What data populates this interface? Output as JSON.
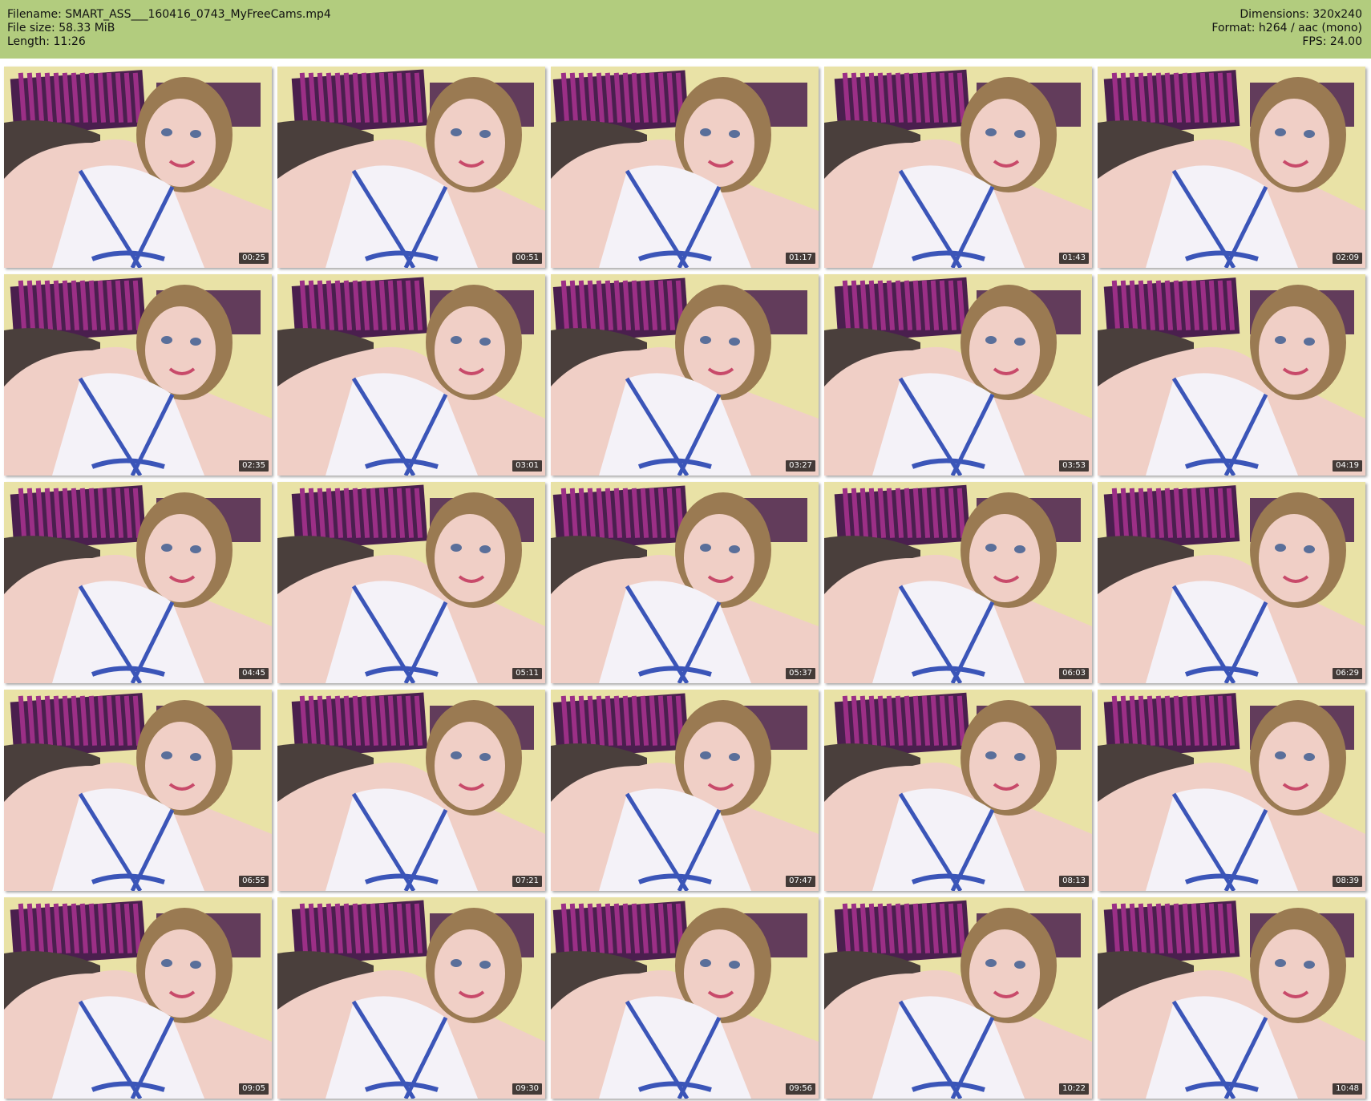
{
  "header": {
    "filename": "Filename: SMART_ASS___160416_0743_MyFreeCams.mp4",
    "file_size": "File size: 58.33 MiB",
    "length": "Length: 11:26",
    "dimensions": "Dimensions: 320x240",
    "format": "Format: h264 / aac (mono)",
    "fps": "FPS: 24.00"
  },
  "thumbnails": [
    {
      "time": "00:25"
    },
    {
      "time": "00:51"
    },
    {
      "time": "01:17"
    },
    {
      "time": "01:43"
    },
    {
      "time": "02:09"
    },
    {
      "time": "02:35"
    },
    {
      "time": "03:01"
    },
    {
      "time": "03:27"
    },
    {
      "time": "03:53"
    },
    {
      "time": "04:19"
    },
    {
      "time": "04:45"
    },
    {
      "time": "05:11"
    },
    {
      "time": "05:37"
    },
    {
      "time": "06:03"
    },
    {
      "time": "06:29"
    },
    {
      "time": "06:55"
    },
    {
      "time": "07:21"
    },
    {
      "time": "07:47"
    },
    {
      "time": "08:13"
    },
    {
      "time": "08:39"
    },
    {
      "time": "09:05"
    },
    {
      "time": "09:30"
    },
    {
      "time": "09:56"
    },
    {
      "time": "10:22"
    },
    {
      "time": "10:48"
    }
  ],
  "colors": {
    "header_bg": "#b2cc7e",
    "wall": "#e9e2a6",
    "stripe_dark": "#4a1f4e",
    "stripe_light": "#9b2f86",
    "skin": "#f0cfc6",
    "top": "#f4f2f8",
    "strap": "#3b55b8",
    "hair": "#9a7a52",
    "couch": "#4a3f3c"
  }
}
